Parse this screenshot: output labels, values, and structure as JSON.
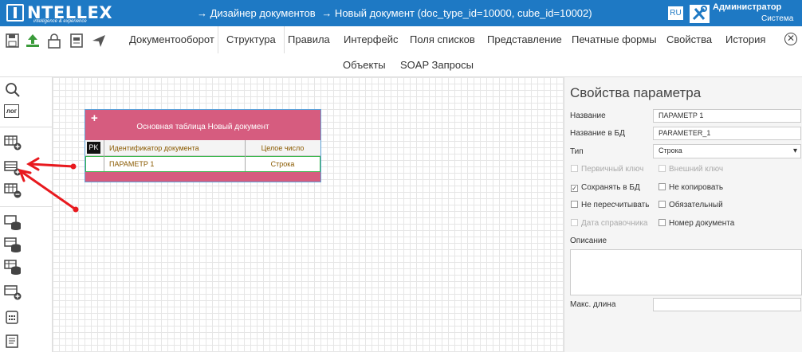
{
  "header": {
    "logo_text": "NTELLEX",
    "logo_sub": "intelligence & experience",
    "breadcrumb": [
      "→ Дизайнер документов",
      "→ Новый документ (doc_type_id=10000, cube_id=10002)"
    ],
    "lang": "RU",
    "user_name": "Администратор",
    "user_role": "Система"
  },
  "tabs_row1": [
    "Документооборот",
    "Структура",
    "Правила",
    "Интерфейс",
    "Поля списков",
    "Представление",
    "Печатные формы",
    "Свойства",
    "История"
  ],
  "tabs_row2": [
    "Объекты",
    "SOAP Запросы"
  ],
  "active_tab": "Структура",
  "sidebar": {
    "log_label": "лог"
  },
  "table": {
    "plus": "+",
    "title": "Основная таблица Новый документ",
    "rows": [
      {
        "key": "PK",
        "name": "Идентификатор документа",
        "type": "Целое число"
      },
      {
        "key": "",
        "name": "ПАРАМЕТР 1",
        "type": "Строка"
      }
    ]
  },
  "props": {
    "title": "Свойства параметра",
    "name_label": "Название",
    "name_value": "ПАРАМЕТР 1",
    "dbname_label": "Название в БД",
    "dbname_value": "PARAMETER_1",
    "type_label": "Тип",
    "type_value": "Строка",
    "checkboxes": {
      "primary_key": "Первичный ключ",
      "foreign_key": "Внешний ключ",
      "save_db": "Сохранять в БД",
      "no_copy": "Не копировать",
      "no_recalc": "Не пересчитывать",
      "required": "Обязательный",
      "ref_date": "Дата справочника",
      "doc_number": "Номер документа"
    },
    "desc_label": "Описание",
    "maxlen_label": "Макс. длина"
  },
  "colors": {
    "header_blue": "#1e79c4",
    "table_pink": "#d65c7f",
    "row_green": "#3db84f",
    "arrow_red": "#e8191e"
  }
}
